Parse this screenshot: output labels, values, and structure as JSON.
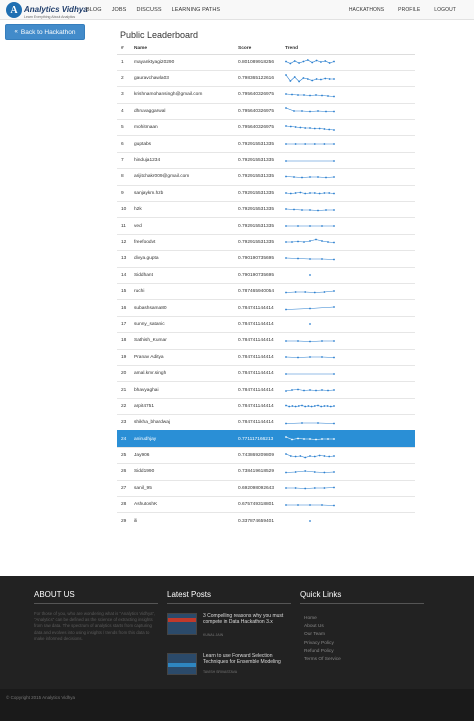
{
  "brand": {
    "name": "Analytics Vidhya",
    "tagline": "Learn Everything About Analytics",
    "mark": "A"
  },
  "nav_left": [
    "BLOG",
    "JOBS",
    "DISCUSS",
    "LEARNING PATHS"
  ],
  "nav_right": [
    "HACKATHONS",
    "PROFILE",
    "LOGOUT"
  ],
  "back_button": {
    "label": "Back to Hackathon",
    "icon": "double-chevron-left-icon"
  },
  "page_title": "Public Leaderboard",
  "table": {
    "headers": [
      "#",
      "Name",
      "Score",
      "Trend"
    ],
    "highlight_rank": "24",
    "rows": [
      {
        "rank": "1",
        "name": "mayanktyagi20290",
        "score": "0.801089918256",
        "trend": [
          0.55,
          0.35,
          0.6,
          0.4,
          0.55,
          0.7,
          0.45,
          0.65,
          0.5,
          0.6,
          0.4,
          0.55
        ]
      },
      {
        "rank": "2",
        "name": "gauravchawla03",
        "score": "0.798365122616",
        "trend": [
          0.9,
          0.3,
          0.7,
          0.25,
          0.6,
          0.5,
          0.35,
          0.5,
          0.45,
          0.55,
          0.5,
          0.5
        ]
      },
      {
        "rank": "3",
        "name": "krishnamohansingh@gmail.com",
        "score": "0.795640326975",
        "trend": [
          0.6,
          0.55,
          0.5,
          0.5,
          0.45,
          0.5,
          0.45,
          0.4,
          0.35
        ]
      },
      {
        "rank": "4",
        "name": "dhruvaggarwal",
        "score": "0.795640326975",
        "trend": [
          0.8,
          0.5,
          0.5,
          0.45,
          0.5,
          0.45,
          0.45
        ]
      },
      {
        "rank": "5",
        "name": "mohitmaan",
        "score": "0.795640326975",
        "trend": [
          0.7,
          0.65,
          0.6,
          0.55,
          0.5,
          0.5,
          0.45,
          0.45,
          0.4,
          0.35,
          0.3
        ]
      },
      {
        "rank": "6",
        "name": "guptabs",
        "score": "0.792915531335",
        "trend": [
          0.5,
          0.5,
          0.5,
          0.5,
          0.5,
          0.5
        ]
      },
      {
        "rank": "7",
        "name": "hinduja1234",
        "score": "0.792915531335",
        "trend": [
          0.5,
          0.5
        ]
      },
      {
        "rank": "8",
        "name": "arijitchakr009@gmail.com",
        "score": "0.792915531335",
        "trend": [
          0.55,
          0.5,
          0.45,
          0.5,
          0.5,
          0.45,
          0.5
        ]
      },
      {
        "rank": "9",
        "name": "sanjaykm.hzb",
        "score": "0.792915531335",
        "trend": [
          0.5,
          0.45,
          0.5,
          0.55,
          0.45,
          0.5,
          0.5,
          0.45,
          0.5,
          0.5,
          0.45
        ]
      },
      {
        "rank": "10",
        "name": "h2k",
        "score": "0.792915531335",
        "trend": [
          0.6,
          0.55,
          0.5,
          0.5,
          0.45,
          0.5,
          0.5
        ]
      },
      {
        "rank": "11",
        "name": "ved",
        "score": "0.792915531335",
        "trend": [
          0.5,
          0.5,
          0.5,
          0.5,
          0.5
        ]
      },
      {
        "rank": "12",
        "name": "freefoodvt",
        "score": "0.792915531335",
        "trend": [
          0.5,
          0.5,
          0.55,
          0.5,
          0.6,
          0.75,
          0.6,
          0.5,
          0.45
        ]
      },
      {
        "rank": "13",
        "name": "divya.gupta",
        "score": "0.790190735695",
        "trend": [
          0.6,
          0.55,
          0.5,
          0.5,
          0.45
        ]
      },
      {
        "rank": "14",
        "name": "Siddhant",
        "score": "0.790190735695",
        "trend": [
          0.5
        ]
      },
      {
        "rank": "15",
        "name": "ruchi",
        "score": "0.787465940054",
        "trend": [
          0.45,
          0.5,
          0.5,
          0.45,
          0.5,
          0.6
        ]
      },
      {
        "rank": "16",
        "name": "subashsama80",
        "score": "0.784741144414",
        "trend": [
          0.35,
          0.45,
          0.6
        ]
      },
      {
        "rank": "17",
        "name": "sunny_satanic",
        "score": "0.784741144414",
        "trend": [
          0.5
        ]
      },
      {
        "rank": "18",
        "name": "Sathish_Kumar",
        "score": "0.784741144414",
        "trend": [
          0.5,
          0.5,
          0.45,
          0.5,
          0.5
        ]
      },
      {
        "rank": "19",
        "name": "Pranav Aditya",
        "score": "0.784741144414",
        "trend": [
          0.5,
          0.45,
          0.5,
          0.5,
          0.45
        ]
      },
      {
        "rank": "20",
        "name": "amal.kmr.singh",
        "score": "0.784741144414",
        "trend": [
          0.5,
          0.5
        ]
      },
      {
        "rank": "21",
        "name": "bhavyaghai",
        "score": "0.784741144414",
        "trend": [
          0.4,
          0.5,
          0.55,
          0.45,
          0.5,
          0.45,
          0.5,
          0.45,
          0.5
        ]
      },
      {
        "rank": "22",
        "name": "arpit4751",
        "score": "0.784741144414",
        "trend": [
          0.55,
          0.45,
          0.5,
          0.45,
          0.5,
          0.55,
          0.45,
          0.5,
          0.45,
          0.5,
          0.55,
          0.45,
          0.5,
          0.5,
          0.45,
          0.5
        ]
      },
      {
        "rank": "23",
        "name": "shikha_bhardwaj",
        "score": "0.784741144414",
        "trend": [
          0.45,
          0.5,
          0.5,
          0.45
        ]
      },
      {
        "rank": "24",
        "name": "anirudhjay",
        "score": "0.771117166213",
        "trend": [
          0.7,
          0.45,
          0.55,
          0.5,
          0.5,
          0.45,
          0.5,
          0.5,
          0.5
        ]
      },
      {
        "rank": "25",
        "name": "Jay906",
        "score": "0.743869209809",
        "trend": [
          0.7,
          0.5,
          0.45,
          0.5,
          0.35,
          0.5,
          0.45,
          0.55,
          0.5,
          0.45,
          0.5
        ]
      },
      {
        "rank": "26",
        "name": "Sidd1990",
        "score": "0.738419618529",
        "trend": [
          0.45,
          0.5,
          0.6,
          0.5,
          0.45,
          0.5
        ]
      },
      {
        "rank": "27",
        "name": "sanil_95",
        "score": "0.692098092643",
        "trend": [
          0.5,
          0.5,
          0.45,
          0.5,
          0.5,
          0.55
        ]
      },
      {
        "rank": "28",
        "name": "AshutoshK",
        "score": "0.675749318801",
        "trend": [
          0.5,
          0.5,
          0.5,
          0.5,
          0.45
        ]
      },
      {
        "rank": "29",
        "name": "ili",
        "score": "0.337874659401",
        "trend": [
          0.5
        ]
      }
    ]
  },
  "footer": {
    "about": {
      "heading": "ABOUT US",
      "text": "For those of you, who are wondering what is \"Analytics Vidhya\", \"Analytics\" can be defined as the science of extracting insights from raw data. The spectrum of analytics starts from capturing data and evolves into using insights / trends from this data to make informed decisions."
    },
    "posts": {
      "heading": "Latest Posts",
      "items": [
        {
          "title": "3 Compelling reasons why you must compete in Data Hackathon 3.x",
          "author": "KUNAL JAIN"
        },
        {
          "title": "Learn to use Forward Selection Techniques for Ensemble Modeling",
          "author": "TAVISH SRIVASTAVA"
        }
      ]
    },
    "links": {
      "heading": "Quick Links",
      "items": [
        "Home",
        "About Us",
        "Our Team",
        "Privacy Policy",
        "Refund Policy",
        "Terms Of Service"
      ]
    },
    "copyright": "© Copyright 2015 Analytics Vidhya"
  },
  "colors": {
    "accent": "#428bca",
    "highlight_row": "#2a8fd6",
    "footer_bg": "#222222",
    "spark": "#2a7fcf"
  }
}
